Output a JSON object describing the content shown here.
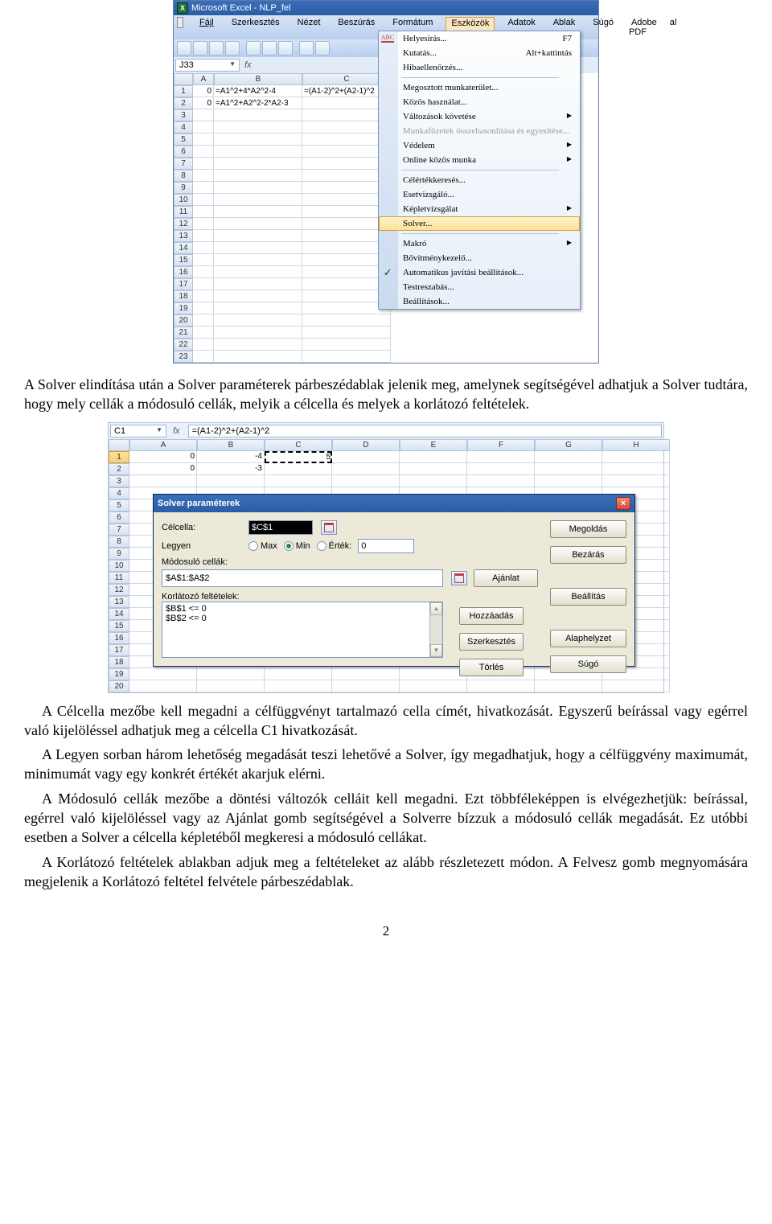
{
  "excel1": {
    "title": "Microsoft Excel - NLP_fel",
    "menubar": [
      "Fájl",
      "Szerkesztés",
      "Nézet",
      "Beszúrás",
      "Formátum",
      "Eszközök",
      "Adatok",
      "Ablak",
      "Súgó",
      "Adobe PDF"
    ],
    "active_menu_index": 5,
    "namebox": "J33",
    "columns": [
      "A",
      "B",
      "C"
    ],
    "rows_visible": 23,
    "data": {
      "r1": {
        "A": "0",
        "B": "=A1^2+4*A2^2-4",
        "C": "=(A1-2)^2+(A2-1)^2"
      },
      "r2": {
        "A": "0",
        "B": "=A1^2+A2^2-2*A2-3",
        "C": ""
      }
    },
    "trailing_tab_hint": "al"
  },
  "dropdown": [
    {
      "label": "Helyesírás...",
      "shortcut": "F7",
      "icon": "abc"
    },
    {
      "label": "Kutatás...",
      "shortcut": "Alt+kattintás"
    },
    {
      "label": "Hibaellenőrzés..."
    },
    {
      "sep": true
    },
    {
      "label": "Megosztott munkaterület..."
    },
    {
      "label": "Közös használat..."
    },
    {
      "label": "Változások követése",
      "submenu": true
    },
    {
      "label": "Munkafüzetek összehasonlítása és egyesítése...",
      "disabled": true
    },
    {
      "label": "Védelem",
      "submenu": true
    },
    {
      "label": "Online közös munka",
      "submenu": true
    },
    {
      "sep": true
    },
    {
      "label": "Célértékkeresés..."
    },
    {
      "label": "Esetvizsgáló..."
    },
    {
      "label": "Képletvizsgálat",
      "submenu": true
    },
    {
      "label": "Solver...",
      "hover": true
    },
    {
      "sep": true
    },
    {
      "label": "Makró",
      "submenu": true
    },
    {
      "label": "Bővítménykezelő..."
    },
    {
      "label": "Automatikus javítási beállítások...",
      "icon": "tick"
    },
    {
      "label": "Testreszabás..."
    },
    {
      "label": "Beállítások..."
    }
  ],
  "para1": "A Solver elindítása után a Solver paraméterek párbeszédablak jelenik meg, amelynek segítségével adhatjuk a Solver tudtára, hogy mely cellák a módosuló cellák, melyik a célcella és melyek a korlátozó feltételek.",
  "excel2": {
    "namebox": "C1",
    "fx_label": "fx",
    "formula": "=(A1-2)^2+(A2-1)^2",
    "columns": [
      "A",
      "B",
      "C",
      "D",
      "E",
      "F",
      "G",
      "H"
    ],
    "rows_visible": 20,
    "data": {
      "r1": {
        "A": "0",
        "B": "-4",
        "C": "5"
      },
      "r2": {
        "A": "0",
        "B": "-3",
        "C": ""
      }
    }
  },
  "solver": {
    "title": "Solver paraméterek",
    "labels": {
      "celcella": "Célcella:",
      "legyen": "Legyen",
      "max": "Max",
      "min": "Min",
      "ertek": "Érték:",
      "modosulo": "Módosuló cellák:",
      "korlatozo": "Korlátozó feltételek:"
    },
    "celcella_val": "$C$1",
    "ertek_val": "0",
    "modosulo_val": "$A$1:$A$2",
    "constraints": [
      "$B$1 <= 0",
      "$B$2 <= 0"
    ],
    "buttons": {
      "megoldas": "Megoldás",
      "bezaras": "Bezárás",
      "beallitas": "Beállítás",
      "alaphelyzet": "Alaphelyzet",
      "sugo": "Súgó",
      "ajanlat": "Ajánlat",
      "hozzaadas": "Hozzáadás",
      "szerkesztes": "Szerkesztés",
      "torles": "Törlés"
    }
  },
  "para2": "A Célcella mezőbe kell megadni a célfüggvényt tartalmazó cella címét, hivatkozását. Egyszerű beírással vagy egérrel való kijelöléssel adhatjuk meg a célcella C1 hivatkozását.",
  "para3": "A Legyen sorban három lehetőség megadását teszi lehetővé a Solver, így megadhatjuk, hogy a célfüggvény maximumát, minimumát vagy egy konkrét értékét akarjuk elérni.",
  "para4": "A Módosuló cellák mezőbe a döntési változók celláit kell megadni. Ezt többféleképpen is elvégezhetjük: beírással, egérrel való kijelöléssel vagy az Ajánlat gomb segítségével a Solverre bízzuk a módosuló cellák megadását. Ez utóbbi esetben a Solver a célcella képletéből megkeresi a módosuló cellákat.",
  "para5": "A Korlátozó feltételek ablakban adjuk meg a feltételeket az alább részletezett módon. A Felvesz gomb megnyomására megjelenik a Korlátozó feltétel felvétele párbeszédablak.",
  "pageno": "2"
}
